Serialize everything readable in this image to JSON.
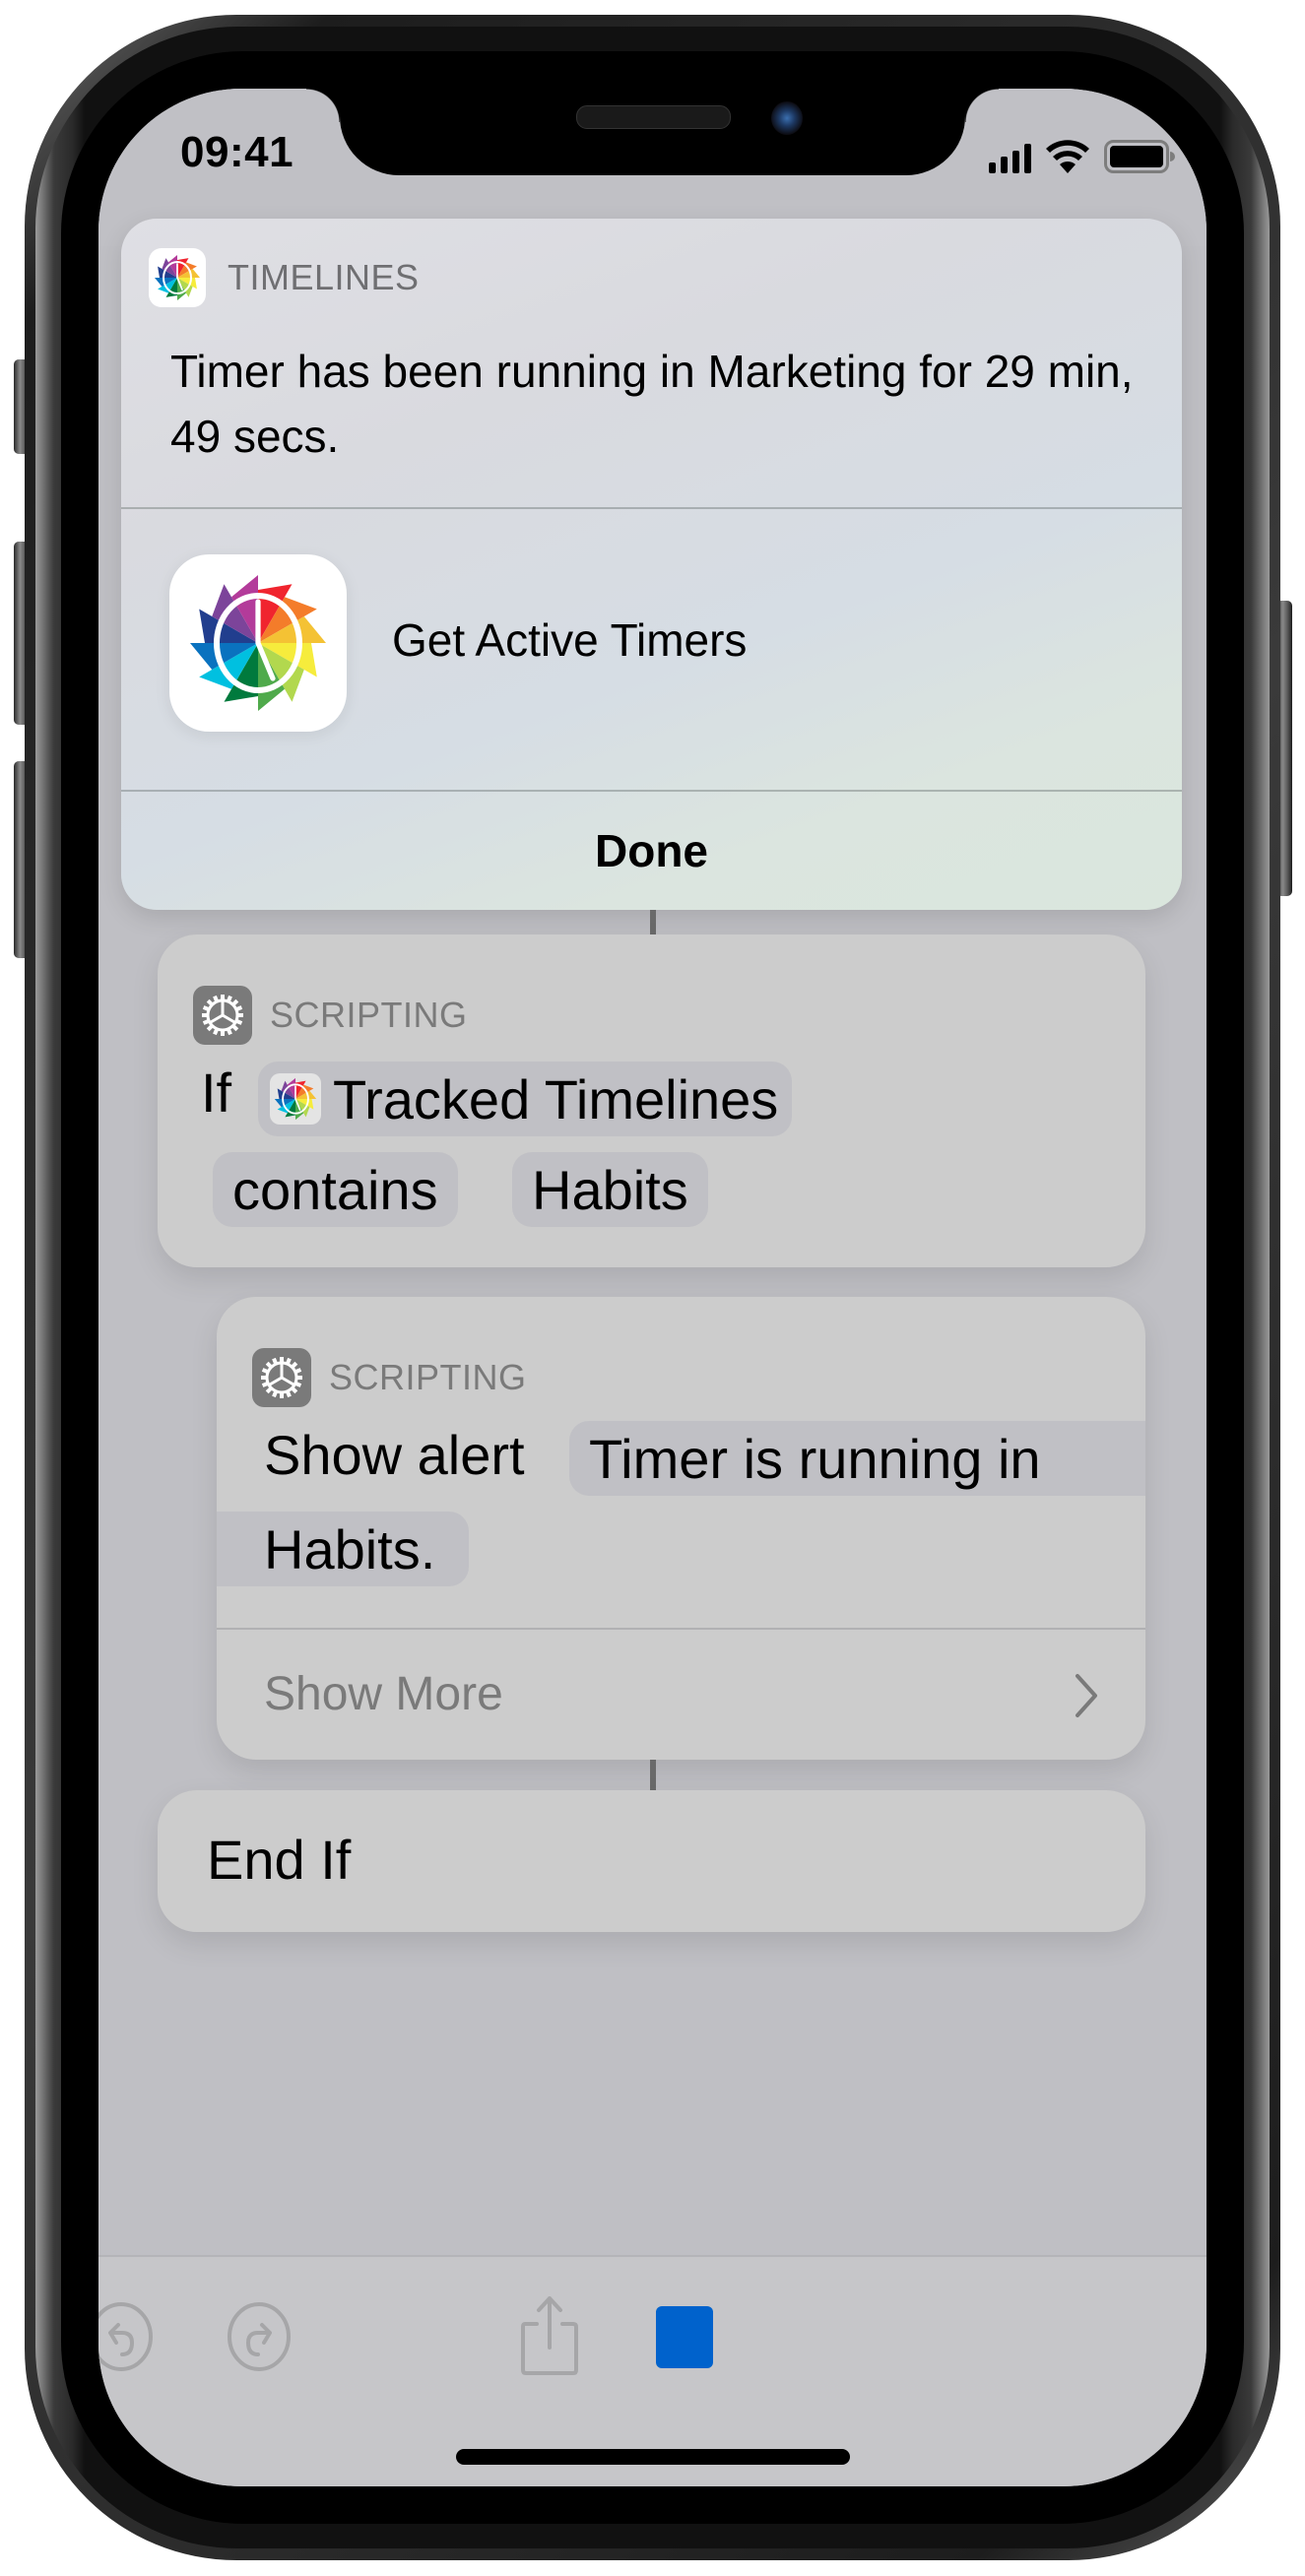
{
  "status_bar": {
    "time": "09:41",
    "icons": [
      "cellular-signal-icon",
      "wifi-icon",
      "battery-icon"
    ]
  },
  "notification": {
    "app_name": "TIMELINES",
    "app_icon": "timelines-app-icon",
    "message": "Timer has been running in Marketing for 29 min, 49 secs.",
    "action": {
      "icon": "timelines-app-icon",
      "label": "Get Active Timers"
    },
    "done_label": "Done"
  },
  "workflow": {
    "if_block": {
      "category": "SCRIPTING",
      "category_icon": "gear-icon",
      "keyword": "If",
      "input_token": "Tracked Timelines",
      "condition_token": "contains",
      "value_token": "Habits"
    },
    "alert_block": {
      "category": "SCRIPTING",
      "category_icon": "gear-icon",
      "action_label": "Show alert",
      "message_line1": "Timer is running in",
      "message_line2": "Habits.",
      "show_more_label": "Show More"
    },
    "end_block": {
      "label": "End If"
    }
  },
  "toolbar": {
    "undo_icon": "undo-icon",
    "redo_icon": "redo-icon",
    "share_icon": "share-icon",
    "stop_icon": "stop-icon",
    "accent_color": "#0062cc"
  }
}
